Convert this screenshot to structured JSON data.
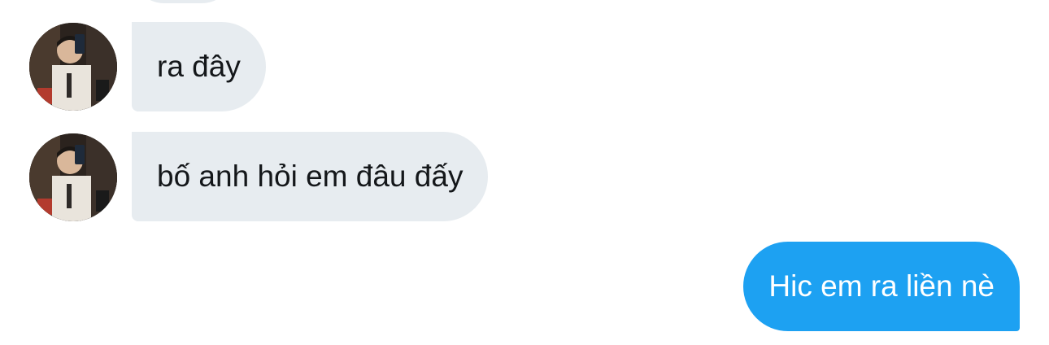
{
  "messages": [
    {
      "sender": "other",
      "text": "ra đây"
    },
    {
      "sender": "other",
      "text": "bố anh hỏi em đâu đấy"
    },
    {
      "sender": "me",
      "text": "Hic em ra liền nè"
    }
  ],
  "colors": {
    "incoming_bubble": "#e7ecf0",
    "incoming_text": "#14171a",
    "outgoing_bubble": "#1da1f2",
    "outgoing_text": "#ffffff",
    "background": "#ffffff"
  },
  "icons": {
    "avatar": "user-avatar-photo"
  }
}
